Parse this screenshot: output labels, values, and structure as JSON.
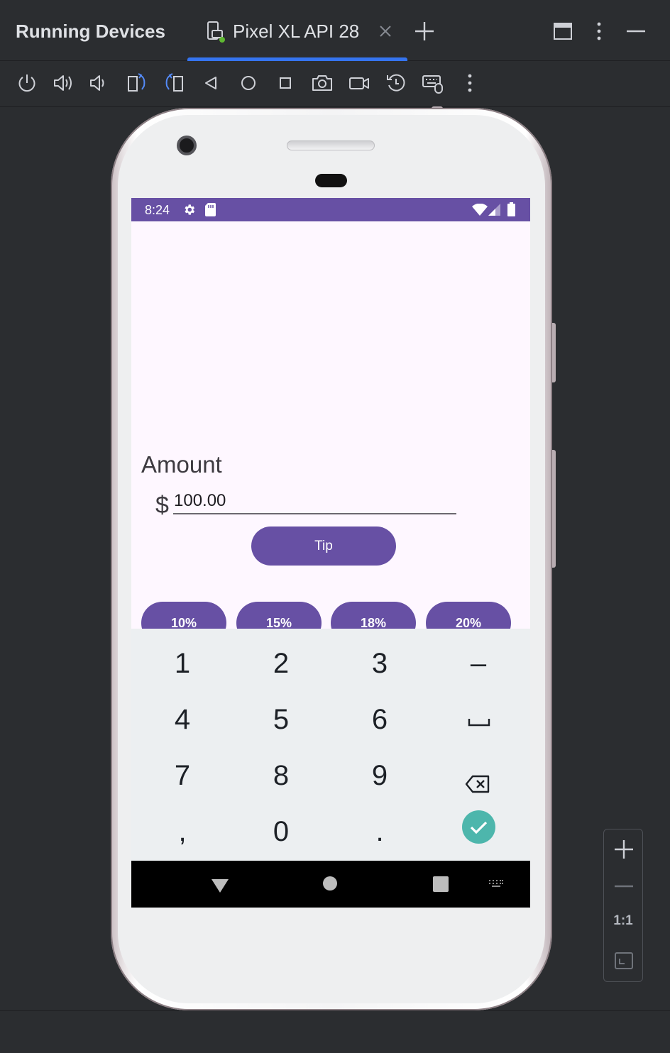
{
  "app_title": "Running Devices",
  "tab": {
    "label": "Pixel XL API 28",
    "status_color": "#5fb832"
  },
  "accent_color": "#3574f0",
  "toolbar_icons": [
    "power-icon",
    "volume-up-icon",
    "volume-down-icon",
    "rotate-left-icon",
    "rotate-right-icon",
    "back-icon",
    "home-icon",
    "overview-icon",
    "screenshot-icon",
    "screen-record-icon",
    "reset-icon",
    "keyboard-icon",
    "more-icon"
  ],
  "statusbar": {
    "time": "8:24",
    "color": "#6750a4"
  },
  "app": {
    "amount_label": "Amount",
    "currency_symbol": "$",
    "amount_value": "100.00",
    "tip_button": "Tip",
    "percent_buttons": [
      "10%",
      "15%",
      "18%",
      "20%"
    ],
    "primary_color": "#6750a4",
    "background_color": "#fef7ff"
  },
  "keyboard": {
    "rows": [
      [
        "1",
        "2",
        "3",
        "–"
      ],
      [
        "4",
        "5",
        "6",
        "space"
      ],
      [
        "7",
        "8",
        "9",
        "backspace"
      ],
      [
        ",",
        "0",
        ".",
        "enter"
      ]
    ],
    "enter_color": "#4db6ac"
  },
  "zoom": {
    "actual_size_label": "1:1"
  }
}
